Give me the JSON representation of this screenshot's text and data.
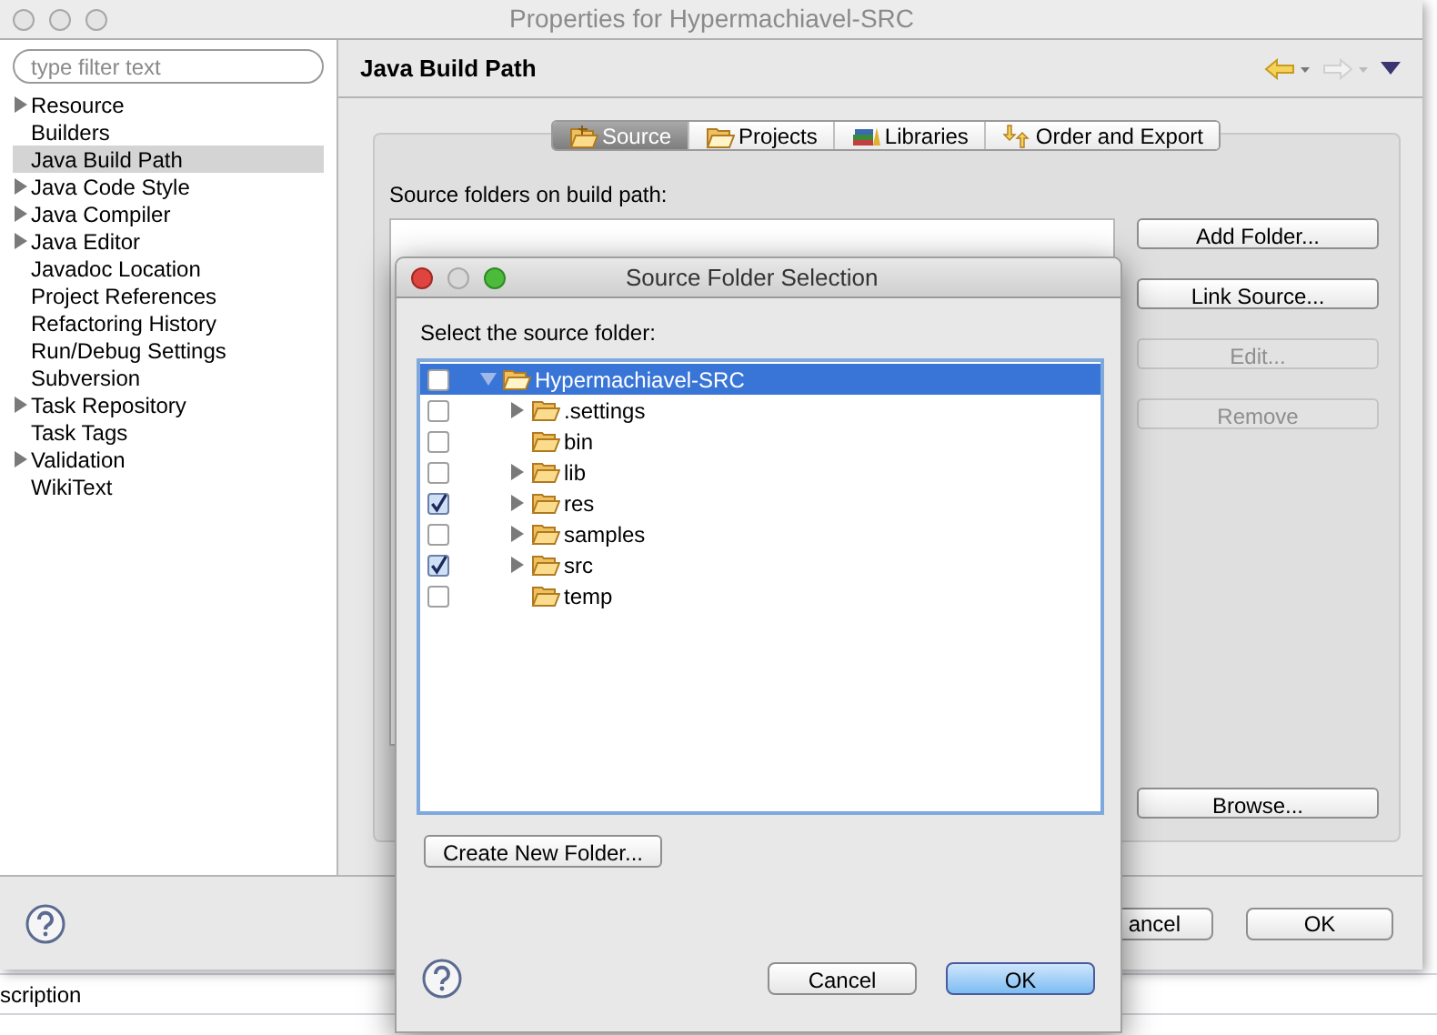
{
  "window": {
    "title": "Properties for Hypermachiavel-SRC"
  },
  "filter": {
    "placeholder": "type filter text"
  },
  "sidebar": {
    "items": [
      {
        "label": "Resource",
        "expanded": false,
        "selected": false
      },
      {
        "label": "Builders",
        "selected": false
      },
      {
        "label": "Java Build Path",
        "selected": true
      },
      {
        "label": "Java Code Style",
        "expanded": false,
        "selected": false
      },
      {
        "label": "Java Compiler",
        "expanded": false,
        "selected": false
      },
      {
        "label": "Java Editor",
        "expanded": false,
        "selected": false
      },
      {
        "label": "Javadoc Location",
        "selected": false
      },
      {
        "label": "Project References",
        "selected": false
      },
      {
        "label": "Refactoring History",
        "selected": false
      },
      {
        "label": "Run/Debug Settings",
        "selected": false
      },
      {
        "label": "Subversion",
        "selected": false
      },
      {
        "label": "Task Repository",
        "expanded": false,
        "selected": false
      },
      {
        "label": "Task Tags",
        "selected": false
      },
      {
        "label": "Validation",
        "expanded": false,
        "selected": false
      },
      {
        "label": "WikiText",
        "selected": false
      }
    ]
  },
  "page": {
    "title": "Java Build Path",
    "tabs": [
      {
        "label": "Source",
        "selected": true
      },
      {
        "label": "Projects",
        "selected": false
      },
      {
        "label": "Libraries",
        "selected": false
      },
      {
        "label": "Order and Export",
        "selected": false
      }
    ],
    "list_label": "Source folders on build path:",
    "side_buttons": [
      {
        "label": "Add Folder...",
        "disabled": false
      },
      {
        "label": "Link Source...",
        "disabled": false
      },
      {
        "label": "Edit...",
        "disabled": true
      },
      {
        "label": "Remove",
        "disabled": true
      }
    ],
    "browse_button": "Browse..."
  },
  "footer_buttons": [
    {
      "label": "ancel"
    },
    {
      "label": "OK"
    }
  ],
  "background_window": {
    "column_header": "scription"
  },
  "dialog": {
    "title": "Source Folder Selection",
    "label": "Select the source folder:",
    "tree": [
      {
        "label": "Hypermachiavel-SRC",
        "checked": false,
        "selected": true,
        "expanded": true,
        "children": [
          {
            "label": ".settings",
            "checked": false,
            "selected": false,
            "expanded": false
          },
          {
            "label": "bin",
            "checked": false,
            "selected": false
          },
          {
            "label": "lib",
            "checked": false,
            "selected": false,
            "expanded": false
          },
          {
            "label": "res",
            "checked": true,
            "selected": false,
            "expanded": false
          },
          {
            "label": "samples",
            "checked": false,
            "selected": false,
            "expanded": false
          },
          {
            "label": "src",
            "checked": true,
            "selected": false,
            "expanded": false
          },
          {
            "label": "temp",
            "checked": false,
            "selected": false
          }
        ]
      }
    ],
    "create_button": "Create New Folder...",
    "buttons": [
      {
        "label": "Cancel",
        "default": false
      },
      {
        "label": "OK",
        "default": true
      }
    ]
  }
}
